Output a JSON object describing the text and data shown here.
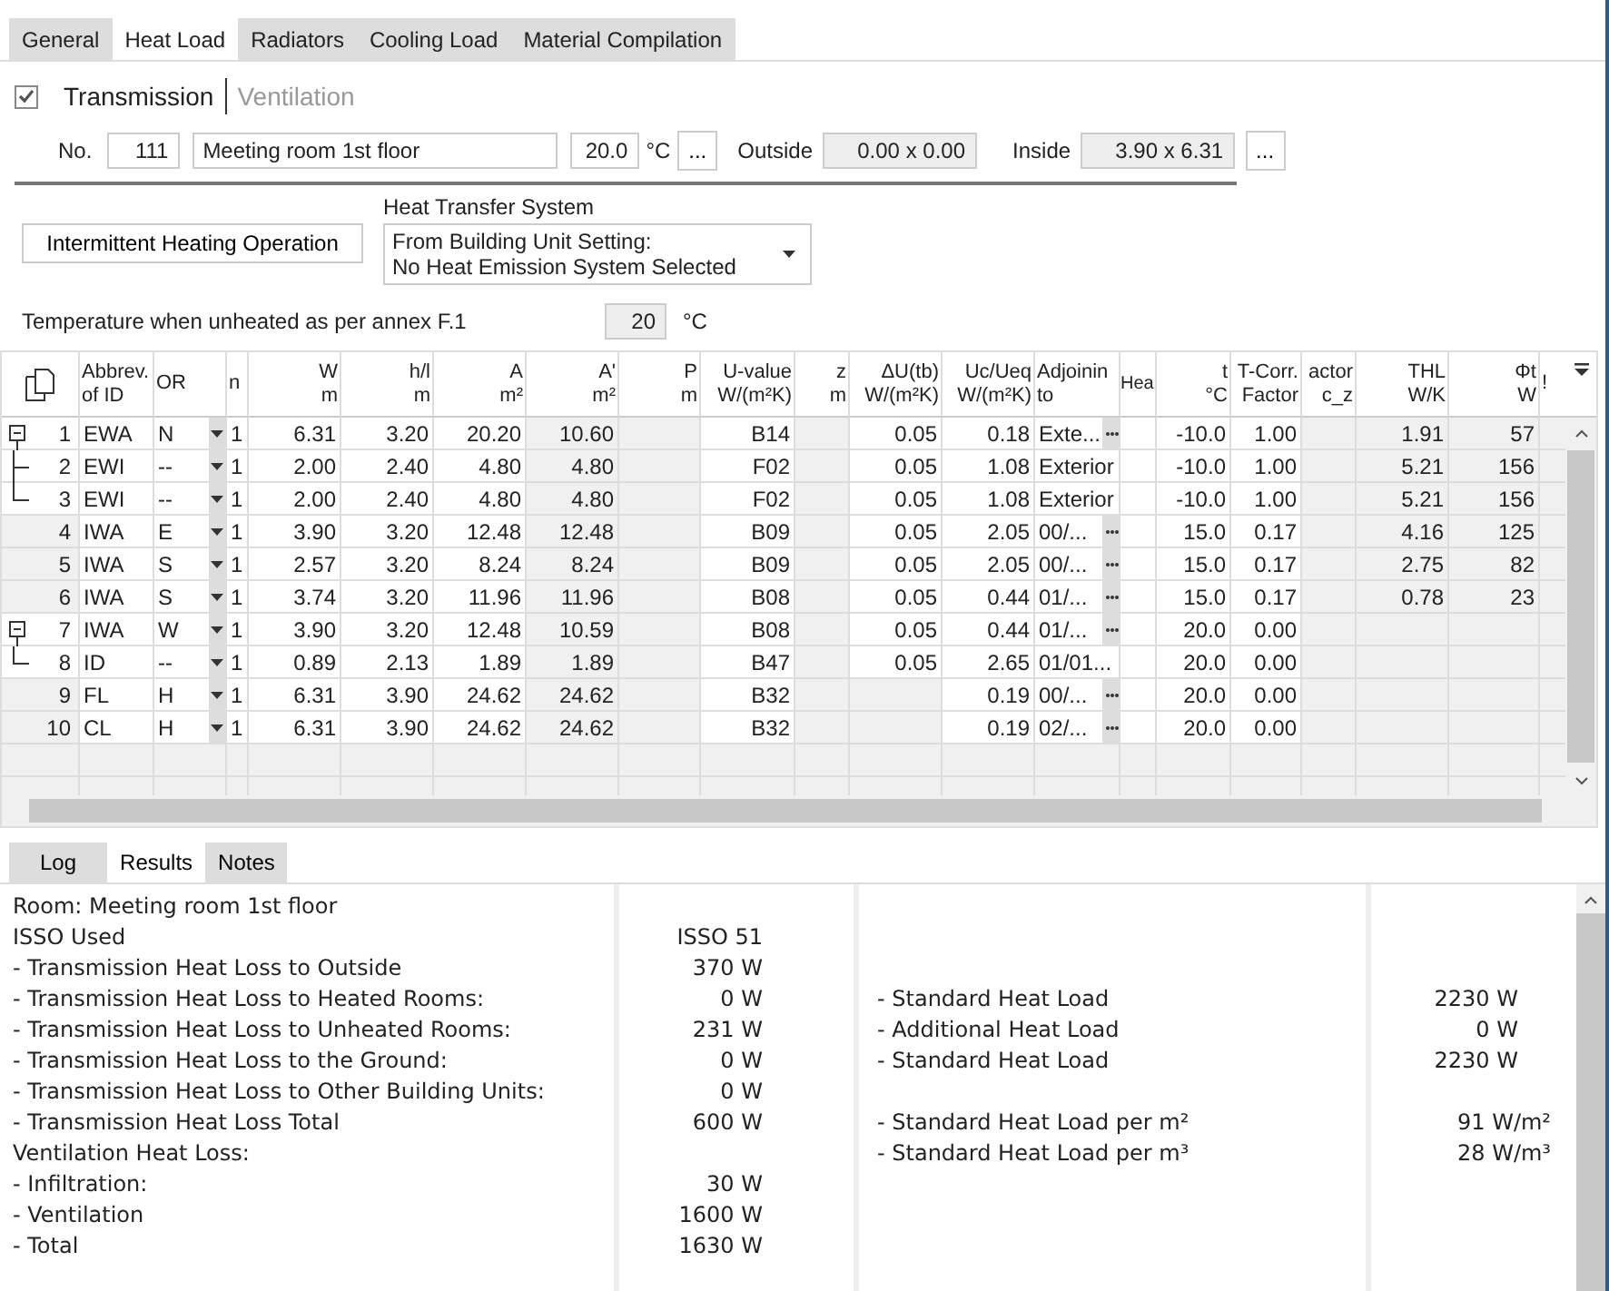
{
  "tabs": [
    {
      "label": "General",
      "selected": false
    },
    {
      "label": "Heat Load",
      "selected": true
    },
    {
      "label": "Radiators",
      "selected": false
    },
    {
      "label": "Cooling Load",
      "selected": false
    },
    {
      "label": "Material Compilation",
      "selected": false
    }
  ],
  "transmission_checked": true,
  "modes": [
    {
      "label": "Transmission",
      "selected": true
    },
    {
      "label": "Ventilation",
      "selected": false
    }
  ],
  "room": {
    "no_label": "No.",
    "no": "111",
    "name": "Meeting room 1st floor",
    "temperature": "20.0",
    "temp_unit": "°C",
    "temp_button": "...",
    "outside_label": "Outside",
    "outside": "0.00 x 0.00",
    "inside_label": "Inside",
    "inside": "3.90 x 6.31",
    "size_button": "..."
  },
  "intermittent_button": "Intermittent Heating Operation",
  "heat_transfer": {
    "label": "Heat Transfer System",
    "lines": [
      "From Building Unit Setting:",
      "No Heat Emission System Selected"
    ]
  },
  "unheated": {
    "label": "Temperature when unheated as per annex F.1",
    "value": "20",
    "unit": "°C"
  },
  "table": {
    "columns": [
      {
        "lines": [
          "Abbrev.",
          "of ID"
        ]
      },
      {
        "lines": [
          "OR"
        ]
      },
      {
        "lines": [
          "n"
        ]
      },
      {
        "lines": [
          "W",
          "m"
        ]
      },
      {
        "lines": [
          "h/l",
          "m"
        ]
      },
      {
        "lines": [
          "A",
          "m²"
        ]
      },
      {
        "lines": [
          "A'",
          "m²"
        ]
      },
      {
        "lines": [
          "P",
          "m"
        ]
      },
      {
        "lines": [
          "U-value",
          "W/(m²K)"
        ]
      },
      {
        "lines": [
          "z",
          "m"
        ]
      },
      {
        "lines": [
          "ΔU(tb)",
          "W/(m²K)"
        ]
      },
      {
        "lines": [
          "Uc/Ueq",
          "W/(m²K)"
        ]
      },
      {
        "lines": [
          "Adjoinin",
          "to"
        ]
      },
      {
        "lines": [
          "Hea"
        ]
      },
      {
        "lines": [
          "t",
          "°C"
        ]
      },
      {
        "lines": [
          "T-Corr.",
          "Factor"
        ]
      },
      {
        "lines": [
          "actor",
          "c_z"
        ]
      },
      {
        "lines": [
          "THL",
          "W/K"
        ]
      },
      {
        "lines": [
          "Φt",
          "W"
        ]
      },
      {
        "lines": [
          "!"
        ]
      }
    ],
    "rows": [
      {
        "no": "1",
        "expanded": true,
        "cells": [
          "EWA",
          "N",
          "1",
          "6.31",
          "3.20",
          "20.20",
          "10.60",
          null,
          "B14",
          null,
          "0.05",
          "0.18",
          "Exte...",
          null,
          "-10.0",
          "1.00",
          null,
          "1.91",
          "57",
          null
        ],
        "adj_button": true,
        "children": [
          {
            "no": "2",
            "cells": [
              "EWI",
              "--",
              "1",
              "2.00",
              "2.40",
              "4.80",
              "4.80",
              null,
              "F02",
              null,
              "0.05",
              "1.08",
              "Exterior",
              null,
              "-10.0",
              "1.00",
              null,
              "5.21",
              "156",
              null
            ],
            "adj_button": false
          },
          {
            "no": "3",
            "cells": [
              "EWI",
              "--",
              "1",
              "2.00",
              "2.40",
              "4.80",
              "4.80",
              null,
              "F02",
              null,
              "0.05",
              "1.08",
              "Exterior",
              null,
              "-10.0",
              "1.00",
              null,
              "5.21",
              "156",
              null
            ],
            "adj_button": false
          }
        ]
      },
      {
        "no": "4",
        "cells": [
          "IWA",
          "E",
          "1",
          "3.90",
          "3.20",
          "12.48",
          "12.48",
          null,
          "B09",
          null,
          "0.05",
          "2.05",
          "00/...",
          null,
          "15.0",
          "0.17",
          null,
          "4.16",
          "125",
          null
        ],
        "adj_button": true
      },
      {
        "no": "5",
        "cells": [
          "IWA",
          "S",
          "1",
          "2.57",
          "3.20",
          "8.24",
          "8.24",
          null,
          "B09",
          null,
          "0.05",
          "2.05",
          "00/...",
          null,
          "15.0",
          "0.17",
          null,
          "2.75",
          "82",
          null
        ],
        "adj_button": true
      },
      {
        "no": "6",
        "cells": [
          "IWA",
          "S",
          "1",
          "3.74",
          "3.20",
          "11.96",
          "11.96",
          null,
          "B08",
          null,
          "0.05",
          "0.44",
          "01/...",
          null,
          "15.0",
          "0.17",
          null,
          "0.78",
          "23",
          null
        ],
        "adj_button": true
      },
      {
        "no": "7",
        "expanded": true,
        "cells": [
          "IWA",
          "W",
          "1",
          "3.90",
          "3.20",
          "12.48",
          "10.59",
          null,
          "B08",
          null,
          "0.05",
          "0.44",
          "01/...",
          null,
          "20.0",
          "0.00",
          null,
          null,
          null,
          null
        ],
        "adj_button": true,
        "children": [
          {
            "no": "8",
            "cells": [
              "ID",
              "--",
              "1",
              "0.89",
              "2.13",
              "1.89",
              "1.89",
              null,
              "B47",
              null,
              "0.05",
              "2.65",
              "01/01...",
              null,
              "20.0",
              "0.00",
              null,
              null,
              null,
              null
            ],
            "adj_button": false
          }
        ]
      },
      {
        "no": "9",
        "cells": [
          "FL",
          "H",
          "1",
          "6.31",
          "3.90",
          "24.62",
          "24.62",
          null,
          "B32",
          null,
          null,
          "0.19",
          "00/...",
          null,
          "20.0",
          "0.00",
          null,
          null,
          null,
          null
        ],
        "adj_button": true
      },
      {
        "no": "10",
        "cells": [
          "CL",
          "H",
          "1",
          "6.31",
          "3.90",
          "24.62",
          "24.62",
          null,
          "B32",
          null,
          null,
          "0.19",
          "02/...",
          null,
          "20.0",
          "0.00",
          null,
          null,
          null,
          null
        ],
        "adj_button": true
      }
    ]
  },
  "bottom_tabs": [
    {
      "label": "Log",
      "selected": false
    },
    {
      "label": "Results",
      "selected": true
    },
    {
      "label": "Notes",
      "selected": false
    }
  ],
  "results": {
    "left": [
      {
        "label": "Room: Meeting room 1st floor"
      },
      {
        "label": "ISSO Used",
        "value": "ISSO 51"
      },
      {
        "label": "- Transmission Heat Loss to Outside",
        "value": "370 W"
      },
      {
        "label": "- Transmission Heat Loss to Heated Rooms:",
        "value": "0 W"
      },
      {
        "label": "- Transmission Heat Loss to Unheated Rooms:",
        "value": "231 W"
      },
      {
        "label": "- Transmission Heat Loss to the Ground:",
        "value": "0 W"
      },
      {
        "label": "- Transmission Heat Loss to Other Building Units:",
        "value": "0 W"
      },
      {
        "label": "- Transmission Heat Loss Total",
        "value": "600 W"
      },
      {
        "label": "Ventilation Heat Loss:"
      },
      {
        "label": "- Infiltration:",
        "value": "30 W"
      },
      {
        "label": "- Ventilation",
        "value": "1600 W"
      },
      {
        "label": "- Total",
        "value": "1630 W"
      }
    ],
    "right": [
      {
        "label": "- Standard Heat Load",
        "value": "2230 W"
      },
      {
        "label": "- Additional Heat Load",
        "value": "0 W"
      },
      {
        "label": "- Standard Heat Load",
        "value": "2230 W"
      },
      {
        "label": "- Standard Heat Load per m²",
        "value": "91 W/m²"
      },
      {
        "label": "- Standard Heat Load per m³",
        "value": "28 W/m³"
      }
    ]
  }
}
